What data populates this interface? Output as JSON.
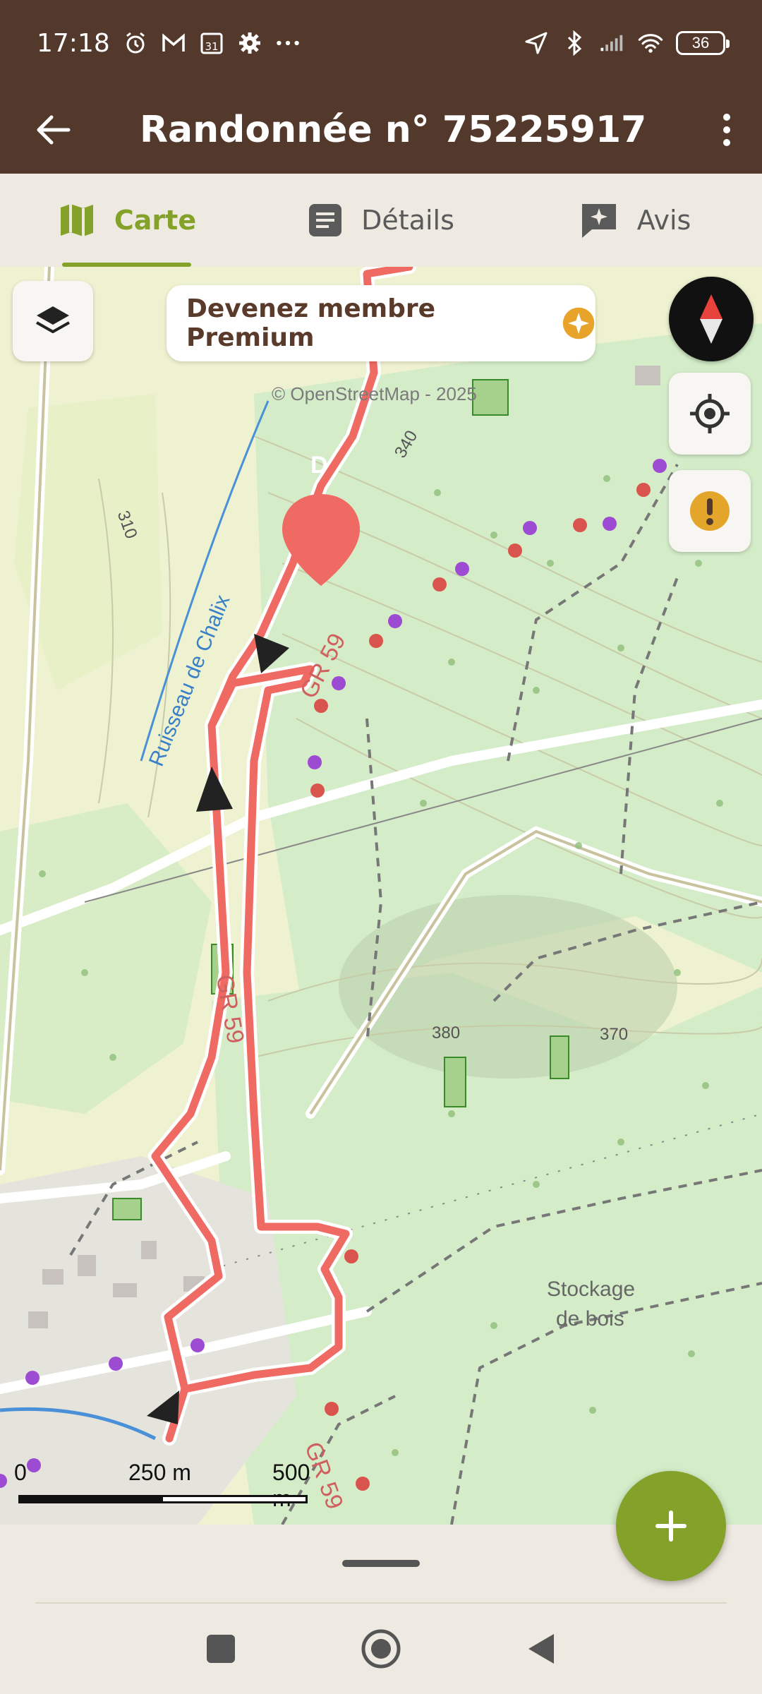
{
  "status_bar": {
    "time": "17:18",
    "battery": "36",
    "icons_left": [
      "alarm-icon",
      "gmail-icon",
      "calendar-icon",
      "settings-icon",
      "more-dots-icon"
    ],
    "icons_right": [
      "location-icon",
      "bluetooth-icon",
      "signal-icon",
      "wifi-icon",
      "battery-icon"
    ]
  },
  "app_bar": {
    "title": "Randonnée n° 75225917",
    "color": "#53382c"
  },
  "tabs": [
    {
      "label": "Carte",
      "icon": "map-icon",
      "active": true
    },
    {
      "label": "Détails",
      "icon": "document-icon",
      "active": false
    },
    {
      "label": "Avis",
      "icon": "review-icon",
      "active": false
    }
  ],
  "map": {
    "premium_banner": "Devenez membre Premium",
    "attribution": "© OpenStreetMap - 2025",
    "start_marker": "D",
    "labels": {
      "stream": "Ruisseau de Chalix",
      "gr_top": "GR 59",
      "gr_middle": "GR 59",
      "gr_bottom": "GR 59",
      "storage_line1": "Stockage",
      "storage_line2": "de bois",
      "alt_310": "310",
      "alt_340": "340",
      "alt_380": "380",
      "alt_370": "370"
    },
    "scale": {
      "zero": "0",
      "mid": "250 m",
      "end": "500 m"
    },
    "route_color": "#e8423c",
    "accent_color": "#84a229"
  },
  "fab": {
    "label": "+"
  },
  "nav": [
    "recent-apps-icon",
    "home-icon",
    "back-icon"
  ]
}
